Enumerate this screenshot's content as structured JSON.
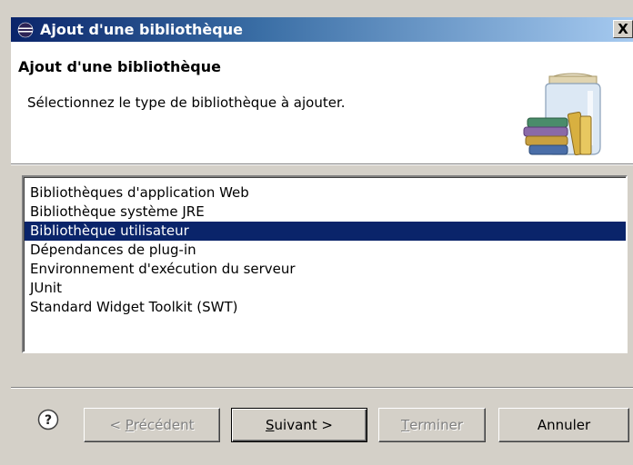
{
  "window": {
    "title": "Ajout d'une bibliothèque",
    "close_label": "X",
    "title_icon": "eclipse-icon"
  },
  "header": {
    "title": "Ajout d'une bibliothèque",
    "description": "Sélectionnez le type de bibliothèque à ajouter.",
    "icon": "library-jar-icon"
  },
  "list": {
    "items": [
      {
        "label": "Bibliothèques d'application Web",
        "selected": false
      },
      {
        "label": "Bibliothèque système JRE",
        "selected": false
      },
      {
        "label": "Bibliothèque utilisateur",
        "selected": true
      },
      {
        "label": "Dépendances de plug-in",
        "selected": false
      },
      {
        "label": "Environnement d'exécution du serveur",
        "selected": false
      },
      {
        "label": "JUnit",
        "selected": false
      },
      {
        "label": "Standard Widget Toolkit (SWT)",
        "selected": false
      }
    ]
  },
  "buttons": {
    "help_icon": "help-icon",
    "prev": {
      "prefix": "< ",
      "mnemonic": "P",
      "rest": "récédent",
      "enabled": false
    },
    "next": {
      "mnemonic": "S",
      "rest": "uivant >",
      "enabled": true
    },
    "finish": {
      "mnemonic": "T",
      "rest": "erminer",
      "enabled": false
    },
    "cancel": {
      "label": "Annuler",
      "enabled": true
    }
  },
  "colors": {
    "selection": "#0a246a",
    "titlebar_start": "#0a246a",
    "titlebar_end": "#a6caf0",
    "dialog_bg": "#d4d0c8"
  }
}
